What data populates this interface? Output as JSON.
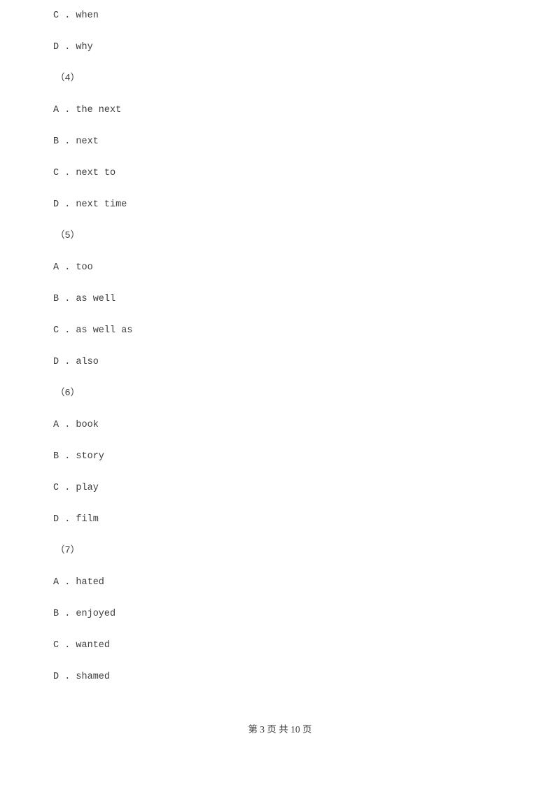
{
  "document": {
    "type": "exam-worksheet",
    "language": "zh-CN",
    "background_color": "#ffffff",
    "text_color": "#3c3c3c"
  },
  "body": {
    "lines": [
      {
        "kind": "option",
        "text": "C . when"
      },
      {
        "kind": "option",
        "text": "D . why"
      },
      {
        "kind": "qnum",
        "text": "（4）"
      },
      {
        "kind": "option",
        "text": "A . the next"
      },
      {
        "kind": "option",
        "text": "B . next"
      },
      {
        "kind": "option",
        "text": "C . next to"
      },
      {
        "kind": "option",
        "text": "D . next time"
      },
      {
        "kind": "qnum",
        "text": "（5）"
      },
      {
        "kind": "option",
        "text": "A . too"
      },
      {
        "kind": "option",
        "text": "B . as well"
      },
      {
        "kind": "option",
        "text": "C . as well as"
      },
      {
        "kind": "option",
        "text": "D . also"
      },
      {
        "kind": "qnum",
        "text": "（6）"
      },
      {
        "kind": "option",
        "text": "A . book"
      },
      {
        "kind": "option",
        "text": "B . story"
      },
      {
        "kind": "option",
        "text": "C . play"
      },
      {
        "kind": "option",
        "text": "D . film"
      },
      {
        "kind": "qnum",
        "text": "（7）"
      },
      {
        "kind": "option",
        "text": "A . hated"
      },
      {
        "kind": "option",
        "text": "B . enjoyed"
      },
      {
        "kind": "option",
        "text": "C . wanted"
      },
      {
        "kind": "option",
        "text": "D . shamed"
      }
    ]
  },
  "footer": {
    "text": "第 3 页 共 10 页",
    "current_page": "3",
    "total_pages": "10"
  }
}
